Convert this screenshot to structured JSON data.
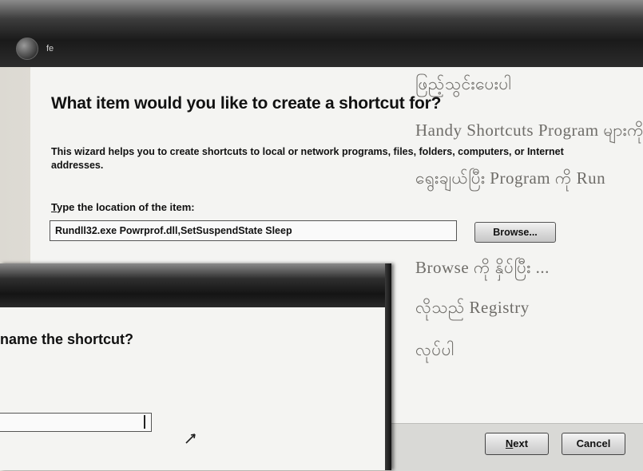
{
  "background_page": {
    "lines": [
      "ဖြည့်သွင်းပေးပါ",
      "Handy Shortcuts Program များကို",
      "ရွေးချယ်ပြီး Program ကို Run",
      "Browse ကို နှိပ်ပြီး ...",
      "လိုသည် Registry",
      "လုပ်ပါ"
    ]
  },
  "wizard": {
    "title": "fe",
    "heading": "What item would you like to create a shortcut for?",
    "description": "This wizard helps you to create shortcuts to local or network programs, files, folders, computers, or Internet addresses.",
    "location_label_accel": "T",
    "location_label_rest": "ype the location of the item:",
    "location_value": "Rundll32.exe Powrprof.dll,SetSuspendState Sleep",
    "browse_label": "Browse...",
    "next_label_accel": "N",
    "next_label_rest": "ext",
    "cancel_label": "Cancel"
  },
  "front_window": {
    "question": "name the shortcut?",
    "name_value": ""
  }
}
